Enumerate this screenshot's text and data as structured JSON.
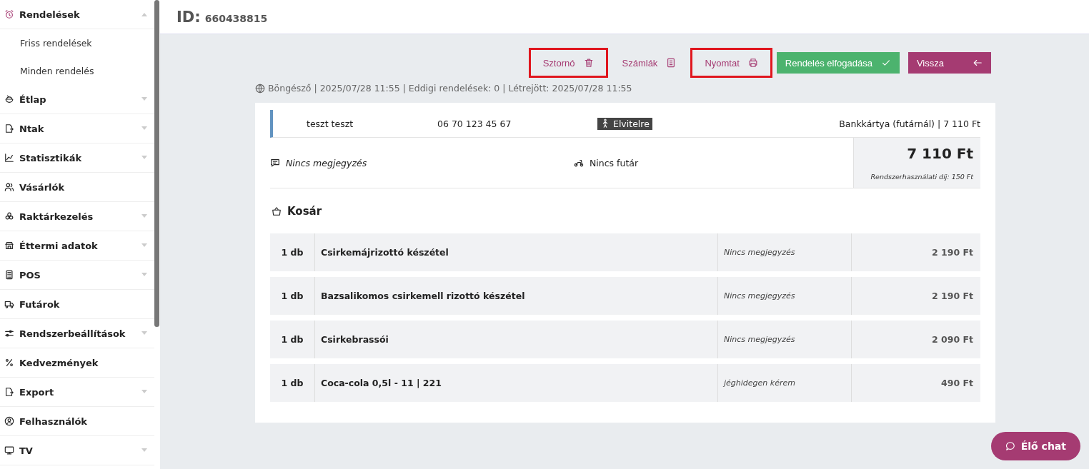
{
  "sidebar": {
    "items": [
      {
        "label": "Rendelések",
        "kind": "group",
        "expanded": true,
        "children": [
          {
            "label": "Friss rendelések"
          },
          {
            "label": "Minden rendelés"
          }
        ]
      },
      {
        "label": "Étlap",
        "kind": "group",
        "expanded": false
      },
      {
        "label": "Ntak",
        "kind": "group",
        "expanded": false
      },
      {
        "label": "Statisztikák",
        "kind": "group",
        "expanded": false
      },
      {
        "label": "Vásárlók",
        "kind": "link"
      },
      {
        "label": "Raktárkezelés",
        "kind": "group",
        "expanded": false
      },
      {
        "label": "Éttermi adatok",
        "kind": "group",
        "expanded": false
      },
      {
        "label": "POS",
        "kind": "group",
        "expanded": false
      },
      {
        "label": "Futárok",
        "kind": "link"
      },
      {
        "label": "Rendszerbeállítások",
        "kind": "group",
        "expanded": false
      },
      {
        "label": "Kedvezmények",
        "kind": "link"
      },
      {
        "label": "Export",
        "kind": "group",
        "expanded": false
      },
      {
        "label": "Felhasználók",
        "kind": "link"
      },
      {
        "label": "TV",
        "kind": "group",
        "expanded": false
      }
    ]
  },
  "header": {
    "id_label": "ID:",
    "id_value": "660438815"
  },
  "actions": [
    {
      "label": "Sztornó",
      "kind": "link",
      "highlighted": true
    },
    {
      "label": "Számlák",
      "kind": "link",
      "highlighted": false
    },
    {
      "label": "Nyomtat",
      "kind": "link",
      "highlighted": true
    },
    {
      "label": "Rendelés elfogadása",
      "kind": "accept",
      "highlighted": false
    },
    {
      "label": "Vissza",
      "kind": "back",
      "highlighted": false
    }
  ],
  "meta": "Böngésző | 2025/07/28 11:55 | Eddigi rendelések: 0 | Létrejött: 2025/07/28 11:55",
  "order": {
    "customer": "teszt teszt",
    "phone": "06 70 123 45 67",
    "delivery": "Elvitelre",
    "payment": "Bankkártya (futárnál) | 7 110 Ft",
    "note": "Nincs megjegyzés",
    "courier": "Nincs futár",
    "total": "7 110 Ft",
    "fee": "Rendszerhasználati díj: 150 Ft"
  },
  "cart": {
    "title": "Kosár",
    "items": [
      {
        "qty": "1 db",
        "name": "Csirkemájrizottó készétel",
        "note": "Nincs megjegyzés",
        "price": "2 190 Ft"
      },
      {
        "qty": "1 db",
        "name": "Bazsalikomos csirkemell rizottó készétel",
        "note": "Nincs megjegyzés",
        "price": "2 190 Ft"
      },
      {
        "qty": "1 db",
        "name": "Csirkebrassói",
        "note": "Nincs megjegyzés",
        "price": "2 090 Ft"
      },
      {
        "qty": "1 db",
        "name": "Coca-cola 0,5l - 11 | 221",
        "note": "jéghidegen kérem",
        "price": "490 Ft"
      }
    ]
  },
  "chat": {
    "label": "Élő chat"
  }
}
